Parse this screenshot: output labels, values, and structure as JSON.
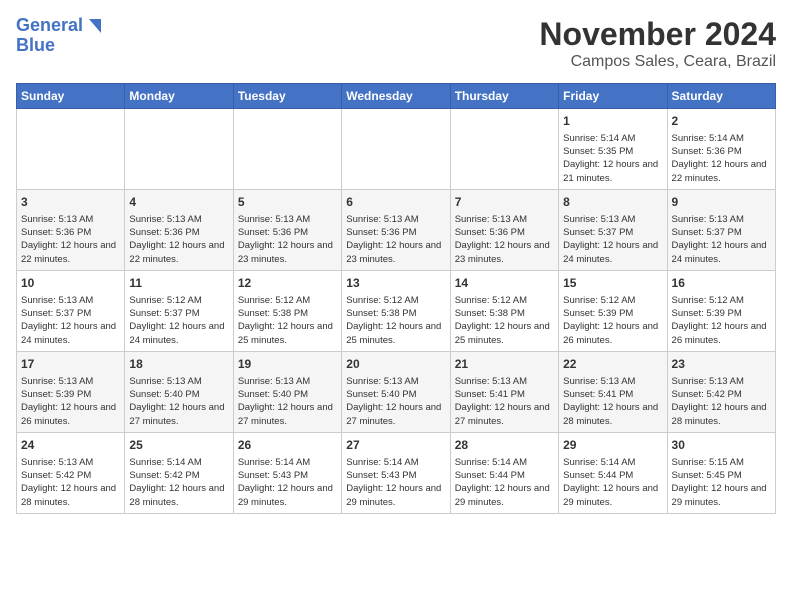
{
  "logo": {
    "line1": "General",
    "line2": "Blue"
  },
  "title": "November 2024",
  "subtitle": "Campos Sales, Ceara, Brazil",
  "days_of_week": [
    "Sunday",
    "Monday",
    "Tuesday",
    "Wednesday",
    "Thursday",
    "Friday",
    "Saturday"
  ],
  "weeks": [
    [
      {
        "day": "",
        "info": ""
      },
      {
        "day": "",
        "info": ""
      },
      {
        "day": "",
        "info": ""
      },
      {
        "day": "",
        "info": ""
      },
      {
        "day": "",
        "info": ""
      },
      {
        "day": "1",
        "info": "Sunrise: 5:14 AM\nSunset: 5:35 PM\nDaylight: 12 hours and 21 minutes."
      },
      {
        "day": "2",
        "info": "Sunrise: 5:14 AM\nSunset: 5:36 PM\nDaylight: 12 hours and 22 minutes."
      }
    ],
    [
      {
        "day": "3",
        "info": "Sunrise: 5:13 AM\nSunset: 5:36 PM\nDaylight: 12 hours and 22 minutes."
      },
      {
        "day": "4",
        "info": "Sunrise: 5:13 AM\nSunset: 5:36 PM\nDaylight: 12 hours and 22 minutes."
      },
      {
        "day": "5",
        "info": "Sunrise: 5:13 AM\nSunset: 5:36 PM\nDaylight: 12 hours and 23 minutes."
      },
      {
        "day": "6",
        "info": "Sunrise: 5:13 AM\nSunset: 5:36 PM\nDaylight: 12 hours and 23 minutes."
      },
      {
        "day": "7",
        "info": "Sunrise: 5:13 AM\nSunset: 5:36 PM\nDaylight: 12 hours and 23 minutes."
      },
      {
        "day": "8",
        "info": "Sunrise: 5:13 AM\nSunset: 5:37 PM\nDaylight: 12 hours and 24 minutes."
      },
      {
        "day": "9",
        "info": "Sunrise: 5:13 AM\nSunset: 5:37 PM\nDaylight: 12 hours and 24 minutes."
      }
    ],
    [
      {
        "day": "10",
        "info": "Sunrise: 5:13 AM\nSunset: 5:37 PM\nDaylight: 12 hours and 24 minutes."
      },
      {
        "day": "11",
        "info": "Sunrise: 5:12 AM\nSunset: 5:37 PM\nDaylight: 12 hours and 24 minutes."
      },
      {
        "day": "12",
        "info": "Sunrise: 5:12 AM\nSunset: 5:38 PM\nDaylight: 12 hours and 25 minutes."
      },
      {
        "day": "13",
        "info": "Sunrise: 5:12 AM\nSunset: 5:38 PM\nDaylight: 12 hours and 25 minutes."
      },
      {
        "day": "14",
        "info": "Sunrise: 5:12 AM\nSunset: 5:38 PM\nDaylight: 12 hours and 25 minutes."
      },
      {
        "day": "15",
        "info": "Sunrise: 5:12 AM\nSunset: 5:39 PM\nDaylight: 12 hours and 26 minutes."
      },
      {
        "day": "16",
        "info": "Sunrise: 5:12 AM\nSunset: 5:39 PM\nDaylight: 12 hours and 26 minutes."
      }
    ],
    [
      {
        "day": "17",
        "info": "Sunrise: 5:13 AM\nSunset: 5:39 PM\nDaylight: 12 hours and 26 minutes."
      },
      {
        "day": "18",
        "info": "Sunrise: 5:13 AM\nSunset: 5:40 PM\nDaylight: 12 hours and 27 minutes."
      },
      {
        "day": "19",
        "info": "Sunrise: 5:13 AM\nSunset: 5:40 PM\nDaylight: 12 hours and 27 minutes."
      },
      {
        "day": "20",
        "info": "Sunrise: 5:13 AM\nSunset: 5:40 PM\nDaylight: 12 hours and 27 minutes."
      },
      {
        "day": "21",
        "info": "Sunrise: 5:13 AM\nSunset: 5:41 PM\nDaylight: 12 hours and 27 minutes."
      },
      {
        "day": "22",
        "info": "Sunrise: 5:13 AM\nSunset: 5:41 PM\nDaylight: 12 hours and 28 minutes."
      },
      {
        "day": "23",
        "info": "Sunrise: 5:13 AM\nSunset: 5:42 PM\nDaylight: 12 hours and 28 minutes."
      }
    ],
    [
      {
        "day": "24",
        "info": "Sunrise: 5:13 AM\nSunset: 5:42 PM\nDaylight: 12 hours and 28 minutes."
      },
      {
        "day": "25",
        "info": "Sunrise: 5:14 AM\nSunset: 5:42 PM\nDaylight: 12 hours and 28 minutes."
      },
      {
        "day": "26",
        "info": "Sunrise: 5:14 AM\nSunset: 5:43 PM\nDaylight: 12 hours and 29 minutes."
      },
      {
        "day": "27",
        "info": "Sunrise: 5:14 AM\nSunset: 5:43 PM\nDaylight: 12 hours and 29 minutes."
      },
      {
        "day": "28",
        "info": "Sunrise: 5:14 AM\nSunset: 5:44 PM\nDaylight: 12 hours and 29 minutes."
      },
      {
        "day": "29",
        "info": "Sunrise: 5:14 AM\nSunset: 5:44 PM\nDaylight: 12 hours and 29 minutes."
      },
      {
        "day": "30",
        "info": "Sunrise: 5:15 AM\nSunset: 5:45 PM\nDaylight: 12 hours and 29 minutes."
      }
    ]
  ]
}
